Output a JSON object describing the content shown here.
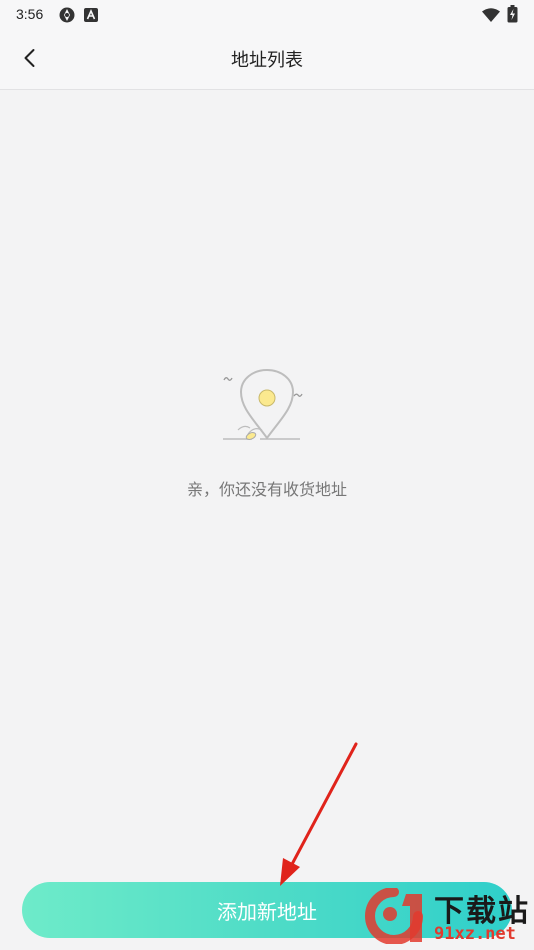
{
  "status_bar": {
    "time": "3:56",
    "icons": [
      "sync-icon",
      "a-badge-icon",
      "wifi-icon",
      "battery-charging-icon"
    ]
  },
  "header": {
    "title": "地址列表",
    "back_icon": "chevron-left-icon"
  },
  "empty_state": {
    "icon": "map-pin-empty-icon",
    "message": "亲，你还没有收货地址"
  },
  "actions": {
    "add_address_label": "添加新地址"
  },
  "watermark": {
    "title": "下载站",
    "site": "91xz.net"
  },
  "colors": {
    "background": "#f3f3f4",
    "button_gradient_start": "#6eebc9",
    "button_gradient_end": "#2fcfca",
    "annotation_arrow": "#e0231b",
    "watermark_red": "#e23a2e"
  }
}
